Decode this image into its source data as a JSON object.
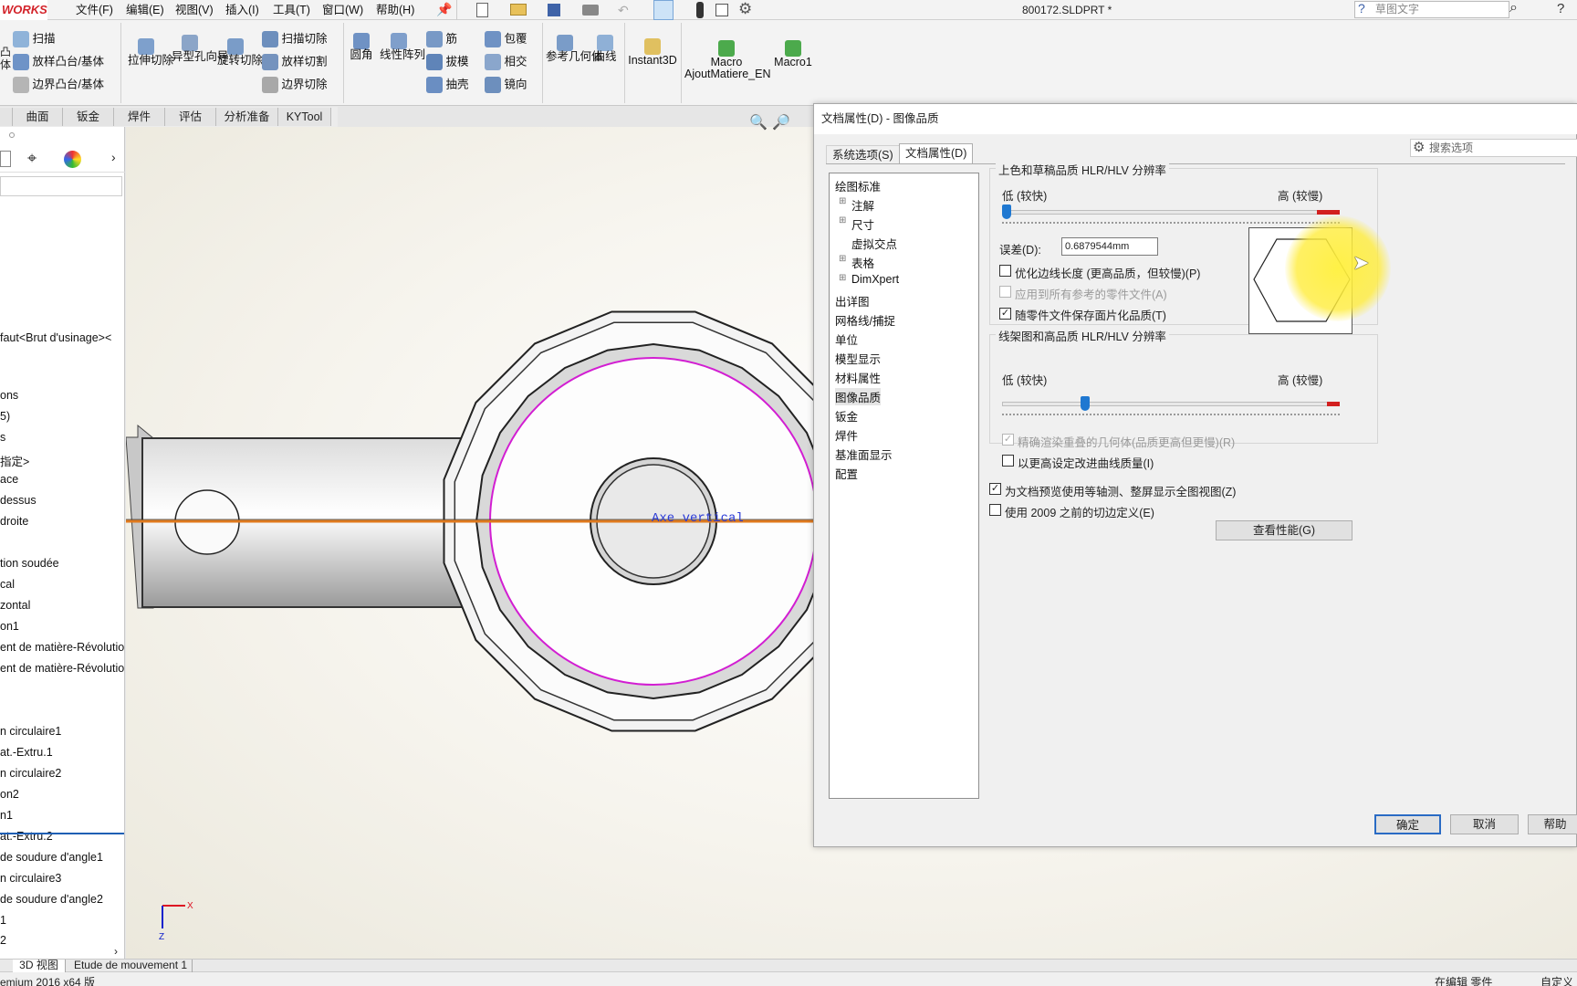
{
  "app": {
    "logo": "WORKS",
    "document_title": "800172.SLDPRT *",
    "search_placeholder": "草图文字"
  },
  "menu": [
    "文件(F)",
    "编辑(E)",
    "视图(V)",
    "插入(I)",
    "工具(T)",
    "窗口(W)",
    "帮助(H)"
  ],
  "ribbon": {
    "sweep": "扫描",
    "loft_boss": "放样凸台/基体",
    "boundary_boss": "边界凸台/基体",
    "extruded_cut": "拉伸切除",
    "hole_wizard": "异型孔向导",
    "revolved_cut": "旋转切除",
    "swept_cut": "扫描切除",
    "lofted_cut": "放样切割",
    "boundary_cut": "边界切除",
    "fillet": "圆角",
    "linear_pattern": "线性阵列",
    "rib": "筋",
    "draft": "拔模",
    "shell": "抽壳",
    "wrap": "包覆",
    "intersect": "相交",
    "mirror": "镜向",
    "ref_geometry": "参考几何体",
    "curves": "曲线",
    "instant3d": "Instant3D",
    "macro1_line1": "Macro",
    "macro1_line2": "AjoutMatiere_EN",
    "macro2": "Macro1"
  },
  "tabs": [
    "曲面",
    "钣金",
    "焊件",
    "评估",
    "分析准备",
    "KYTool"
  ],
  "tree": [
    "faut<Brut d'usinage><",
    "ons",
    "5)",
    "s",
    "指定>",
    "ace",
    "dessus",
    "droite",
    "tion soudée",
    "cal",
    "zontal",
    "on1",
    "ent de matière-Révolutio",
    "ent de matière-Révolutio",
    "n circulaire1",
    "at.-Extru.1",
    "n circulaire2",
    "on2",
    "n1",
    "at.-Extru.2",
    "de soudure d'angle1",
    "n circulaire3",
    "de soudure d'angle2",
    "1",
    "2"
  ],
  "viewport": {
    "axis_label": "Axe vertical",
    "triad_x": "X",
    "triad_z": "Z"
  },
  "bottom_tabs": [
    "3D 视图",
    "Etude de mouvement 1"
  ],
  "status": {
    "left": "emium 2016 x64 版",
    "right1": "在编辑 零件",
    "right2": "自定义"
  },
  "dialog": {
    "title": "文档属性(D) - 图像品质",
    "tab_system": "系统选项(S)",
    "tab_document": "文档属性(D)",
    "search": "搜索选项",
    "tree": [
      "绘图标准",
      "注解",
      "尺寸",
      "虚拟交点",
      "表格",
      "DimXpert",
      "出详图",
      "网格线/捕捉",
      "单位",
      "模型显示",
      "材料属性",
      "图像品质",
      "钣金",
      "焊件",
      "基准面显示",
      "配置"
    ],
    "shaded_group": "上色和草稿品质 HLR/HLV 分辨率",
    "low": "低 (较快)",
    "high": "高 (较慢)",
    "deviation_label": "误差(D):",
    "deviation_value": "0.6879544mm",
    "cb_optimize": "优化边线长度 (更高品质，但较慢)(P)",
    "cb_apply": "应用到所有参考的零件文件(A)",
    "cb_save": "随零件文件保存面片化品质(T)",
    "wire_group": "线架图和高品质 HLR/HLV 分辨率",
    "low2": "低 (较快)",
    "high2": "高 (较慢)",
    "cb_precise": "精确渲染重叠的几何体(品质更高但更慢)(R)",
    "cb_improve": "以更高设定改进曲线质量(I)",
    "cb_trimetric": "为文档预览使用等轴测、整屏显示全图视图(Z)",
    "cb_2009": "使用 2009 之前的切边定义(E)",
    "perf_button": "查看性能(G)",
    "ok": "确定",
    "cancel": "取消",
    "help": "帮助",
    "slider1_level": 0.0,
    "slider2_level": 0.24
  }
}
